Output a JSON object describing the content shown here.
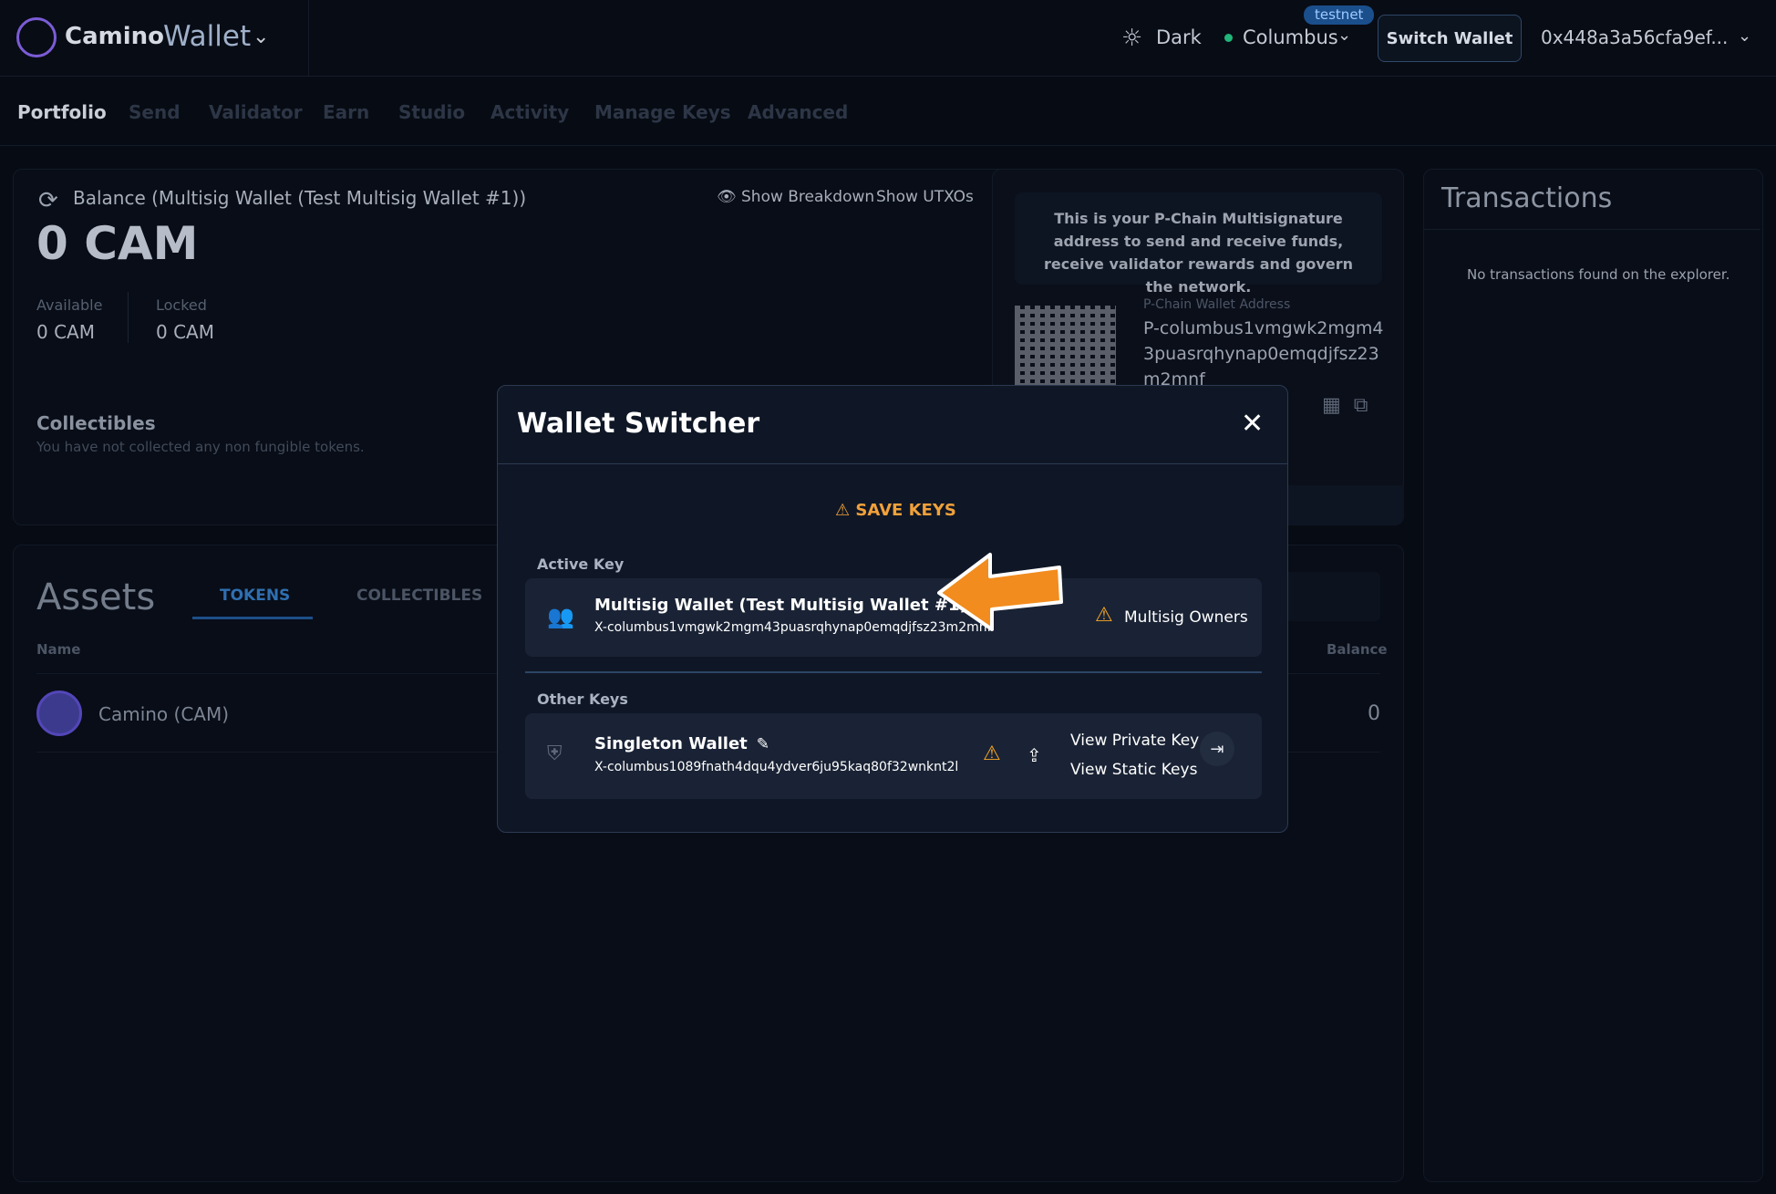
{
  "header": {
    "brand_primary": "Camino",
    "brand_secondary": "Wallet",
    "theme_label": "Dark",
    "network_label": "Columbus",
    "network_badge": "testnet",
    "switch_wallet_label": "Switch Wallet",
    "address_label": "0x448a3a56cfa9ef...",
    "colors": {
      "accent_border": "#2f4868",
      "network_dot": "#21b57a",
      "badge_bg": "#1a4f8c"
    }
  },
  "nav": {
    "items": [
      {
        "label": "Portfolio",
        "active": true
      },
      {
        "label": "Send"
      },
      {
        "label": "Validator"
      },
      {
        "label": "Earn"
      },
      {
        "label": "Studio"
      },
      {
        "label": "Activity"
      },
      {
        "label": "Manage Keys"
      },
      {
        "label": "Advanced"
      }
    ]
  },
  "balance": {
    "title": "Balance (Multisig Wallet (Test Multisig Wallet #1))",
    "value": "0 CAM",
    "show_breakdown": "Show Breakdown",
    "show_utxos": "Show UTXOs",
    "available_label": "Available",
    "available_value": "0 CAM",
    "locked_label": "Locked",
    "locked_value": "0 CAM",
    "collectibles_title": "Collectibles",
    "collectibles_sub": "You have not collected any non fungible tokens."
  },
  "pchain": {
    "info": "This is your P-Chain Multisignature address to send and receive funds, receive validator rewards and govern the network.",
    "address_label": "P-Chain Wallet Address",
    "address": "P-columbus1vmgwk2mgm43puasrqhynap0emqdjfsz23m2mnf"
  },
  "transactions": {
    "title": "Transactions",
    "empty": "No transactions found on the explorer."
  },
  "assets": {
    "title": "Assets",
    "tabs": [
      "TOKENS",
      "COLLECTIBLES"
    ],
    "columns": {
      "name": "Name",
      "balance": "Balance"
    },
    "rows": [
      {
        "name": "Camino (CAM)",
        "balance": "0"
      }
    ]
  },
  "modal": {
    "title": "Wallet Switcher",
    "save_keys": "SAVE KEYS",
    "active_label": "Active Key",
    "active_key": {
      "name": "Multisig Wallet (Test Multisig Wallet #1)",
      "address": "X-columbus1vmgwk2mgm43puasrqhynap0emqdjfsz23m2mnf",
      "owners_label": "Multisig Owners"
    },
    "other_label": "Other Keys",
    "other_keys": [
      {
        "name": "Singleton Wallet",
        "address": "X-columbus1089fnath4dqu4ydver6ju95kaq80f32wnknt2l",
        "view_private_key": "View Private Key",
        "view_static_keys": "View Static Keys"
      }
    ],
    "colors": {
      "warning": "#f5a623",
      "save_keys": "#f1a13a",
      "card_bg": "#1a2335"
    }
  }
}
